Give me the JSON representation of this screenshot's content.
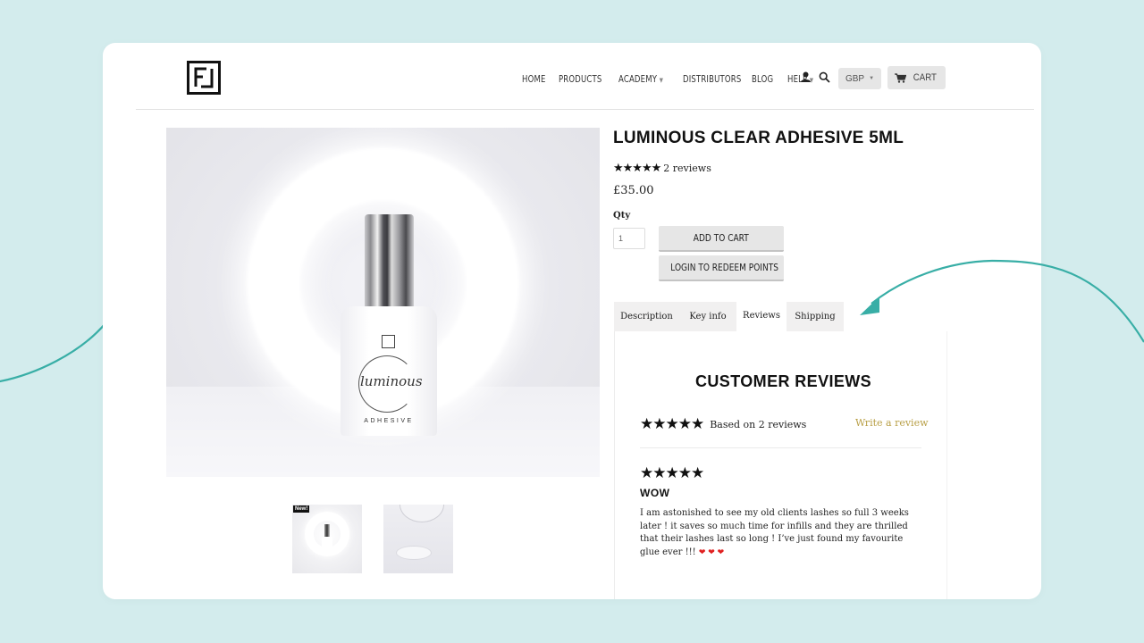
{
  "brand": {
    "logo_letters": "FJ"
  },
  "nav": {
    "items": [
      {
        "label": "HOME",
        "has_dropdown": false
      },
      {
        "label": "PRODUCTS",
        "has_dropdown": false
      },
      {
        "label": "ACADEMY",
        "has_dropdown": true
      },
      {
        "label": "DISTRIBUTORS",
        "has_dropdown": false
      },
      {
        "label": "BLOG",
        "has_dropdown": false
      },
      {
        "label": "HELP",
        "has_dropdown": true
      }
    ],
    "account_icon": "person-icon",
    "search_icon": "search-icon",
    "currency": "GBP",
    "cart_label": "CART",
    "cart_icon": "shopping-cart-icon"
  },
  "product": {
    "title": "LUMINOUS CLEAR ADHESIVE 5ML",
    "rating_stars": "★★★★★",
    "rating": 5,
    "review_count_label": "2 reviews",
    "price": "£35.00",
    "qty_label": "Qty",
    "qty_value": "1",
    "add_to_cart_label": "ADD TO CART",
    "login_points_label": "LOGIN TO REDEEM POINTS",
    "image": {
      "bottle_brand": "luminous",
      "bottle_subtext": "ADHESIVE",
      "bottle_logo": "FJ"
    },
    "thumbnails": [
      {
        "name": "thumbnail-bottle-ring",
        "badge": "New!"
      },
      {
        "name": "thumbnail-closeup",
        "badge": ""
      }
    ]
  },
  "tabs": [
    {
      "label": "Description",
      "active": false
    },
    {
      "label": "Key info",
      "active": false
    },
    {
      "label": "Reviews",
      "active": true
    },
    {
      "label": "Shipping",
      "active": false
    }
  ],
  "reviews": {
    "heading": "CUSTOMER REVIEWS",
    "summary_stars": "★★★★★",
    "summary_text": "Based on 2 reviews",
    "write_review_label": "Write a review",
    "items": [
      {
        "stars": "★★★★★",
        "rating": 5,
        "title": "WOW",
        "body": "I am astonished to see my old clients lashes so full 3 weeks later ! it saves so much time for infills and they are thrilled that their lashes last so long ! I’ve just found my favourite glue ever !!! ",
        "hearts": "❤ ❤ ❤"
      }
    ]
  },
  "colors": {
    "background": "#d3eced",
    "accent_teal": "#38aea6",
    "link_gold": "#b9a048",
    "button_gray": "#e6e6e6"
  }
}
